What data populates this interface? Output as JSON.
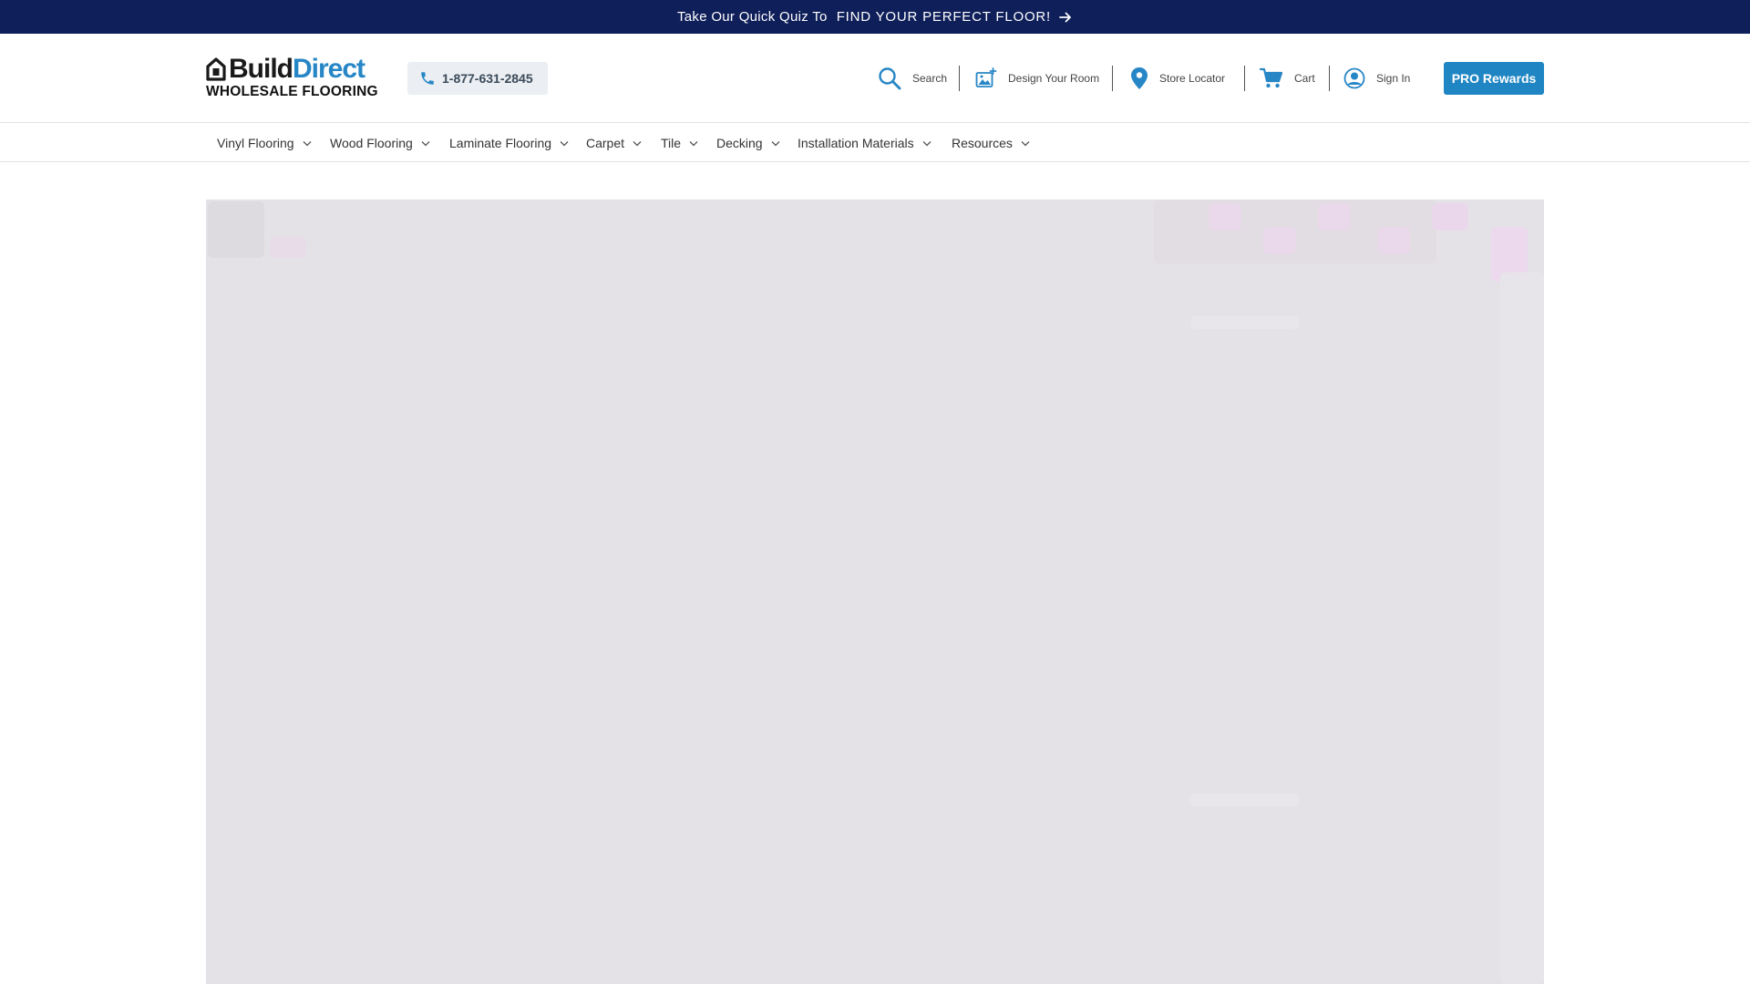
{
  "promo": {
    "lead": "Take Our Quick Quiz To",
    "cta": "FIND YOUR PERFECT FLOOR!",
    "arrow_icon": "arrow-right-icon"
  },
  "brand": {
    "name_part1": "Build",
    "name_part2": "Direct",
    "tagline": "WHOLESALE FLOORING",
    "accent": "#2786c6",
    "dark": "#1a1a1a"
  },
  "contact": {
    "phone": "1-877-631-2845",
    "icon": "phone-icon"
  },
  "utility_nav": {
    "search": "Search",
    "design_room": "Design Your Room",
    "store_locator": "Store Locator",
    "cart": "Cart",
    "sign_in": "Sign In",
    "icon_color": "#2786c6"
  },
  "pro_button": {
    "label": "PRO Rewards",
    "color": "#1f86c3"
  },
  "main_nav": {
    "items": [
      {
        "label": "Vinyl Flooring"
      },
      {
        "label": "Wood Flooring"
      },
      {
        "label": "Laminate Flooring"
      },
      {
        "label": "Carpet"
      },
      {
        "label": "Tile"
      },
      {
        "label": "Decking"
      },
      {
        "label": "Installation Materials"
      },
      {
        "label": "Resources"
      }
    ]
  },
  "colors": {
    "promo_bg": "#0f1f5a",
    "hero_placeholder": "#e4e2e6"
  }
}
